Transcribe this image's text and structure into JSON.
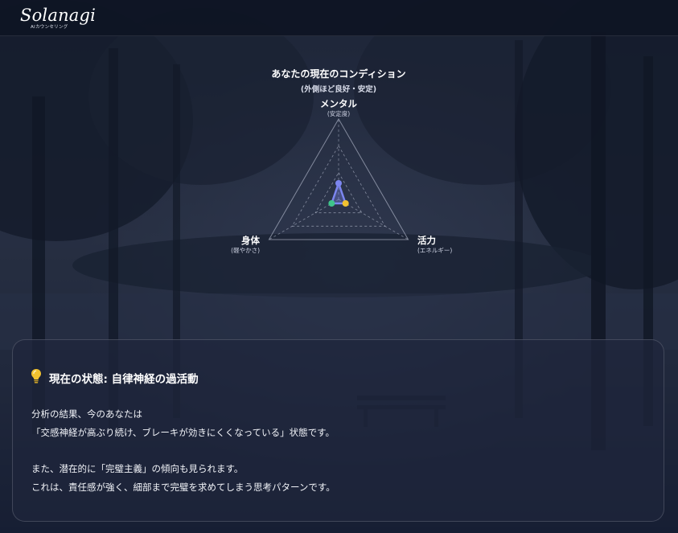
{
  "header": {
    "logo_text": "Solanagi",
    "logo_subtext": "AIカウンセリング"
  },
  "chart_data": {
    "type": "radar",
    "title": "あなたの現在のコンディション",
    "subtitle": "(外側ほど良好・安定)",
    "axes": [
      {
        "label": "メンタル",
        "sublabel": "(安定度)"
      },
      {
        "label": "活力",
        "sublabel": "(エネルギー)"
      },
      {
        "label": "身体",
        "sublabel": "(軽やかさ)"
      }
    ],
    "values": [
      2,
      1,
      1
    ],
    "range": [
      0,
      10
    ],
    "rings": 3,
    "point_colors": [
      "#7c86f0",
      "#f2c230",
      "#3fc48a"
    ],
    "line_color": "#7c86f0"
  },
  "card": {
    "title": "現在の状態: 自律神経の過活動",
    "paragraphs": [
      "分析の結果、今のあなたは",
      "「交感神経が高ぶり続け、ブレーキが効きにくくなっている」状態です。",
      "",
      "また、潜在的に「完璧主義」の傾向も見られます。",
      "これは、責任感が強く、細部まで完璧を求めてしまう思考パターンです。"
    ],
    "icon": "lightbulb-icon"
  },
  "colors": {
    "header_bg": "#0e1424",
    "card_bg": "#1e263c",
    "accent_yellow": "#f2c230"
  }
}
